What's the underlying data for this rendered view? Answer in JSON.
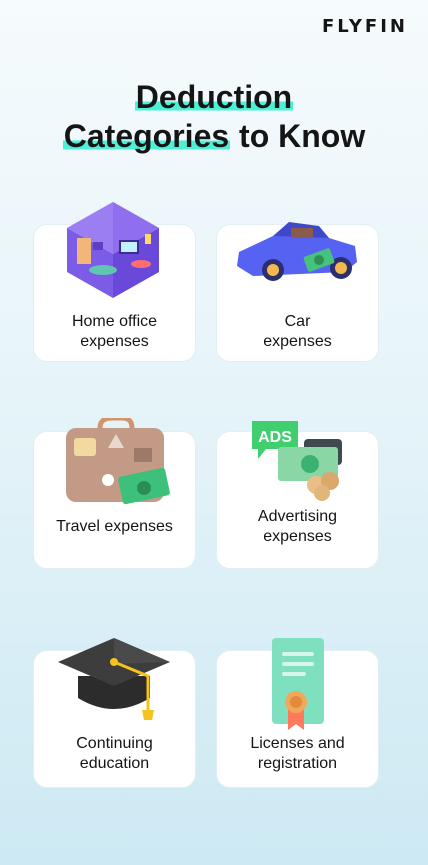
{
  "brand": {
    "logo": "FLYFIN"
  },
  "title": {
    "line1": "Deduction",
    "line2_highlight": "Categories",
    "line2_rest": " to Know"
  },
  "cards": [
    {
      "line1": "Home office",
      "line2": "expenses",
      "icon": "home-office-room-icon"
    },
    {
      "line1": "Car",
      "line2": "expenses",
      "icon": "car-icon"
    },
    {
      "line1": "Travel expenses",
      "line2": "",
      "icon": "suitcase-icon"
    },
    {
      "line1": "Advertising",
      "line2": "expenses",
      "icon": "ads-money-icon"
    },
    {
      "line1": "Continuing",
      "line2": "education",
      "icon": "graduation-cap-icon"
    },
    {
      "line1": "Licenses and",
      "line2": "registration",
      "icon": "certificate-icon"
    }
  ],
  "ads_badge": "ADS",
  "colors": {
    "accent": "#4bf0d6",
    "background_top": "#f6fbfd",
    "background_bottom": "#cde9f3",
    "card": "#ffffff"
  }
}
